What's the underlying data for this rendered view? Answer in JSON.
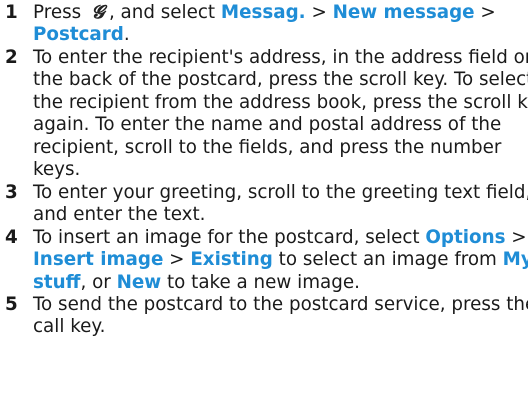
{
  "colors": {
    "text": "#1a1a1a",
    "highlight": "#1f8dd6",
    "background": "#ffffff"
  },
  "icons": {
    "menu_key": "menu-key-icon"
  },
  "steps": [
    {
      "number": "1",
      "lines": [
        [
          {
            "t": "Press "
          },
          {
            "icon": "menu-key-icon",
            "glyph": "𝓖"
          },
          {
            "t": ", and select "
          },
          {
            "t": "Messag.",
            "hl": true
          },
          {
            "t": " > "
          },
          {
            "t": "New message",
            "hl": true
          },
          {
            "t": " >"
          }
        ],
        [
          {
            "t": "Postcard",
            "hl": true
          },
          {
            "t": "."
          }
        ]
      ]
    },
    {
      "number": "2",
      "lines": [
        [
          {
            "t": " To enter the recipient's address, in the address field on"
          }
        ],
        [
          {
            "t": "the back of the postcard, press the scroll key. To select"
          }
        ],
        [
          {
            "t": "the recipient from the address book, press the scroll key"
          }
        ],
        [
          {
            "t": "again. To enter the name and postal address of the"
          }
        ],
        [
          {
            "t": "recipient, scroll to the fields, and press the number"
          }
        ],
        [
          {
            "t": "keys."
          }
        ]
      ]
    },
    {
      "number": "3",
      "lines": [
        [
          {
            "t": "To enter your greeting, scroll to the greeting text field,"
          }
        ],
        [
          {
            "t": "and enter the text."
          }
        ]
      ]
    },
    {
      "number": "4",
      "lines": [
        [
          {
            "t": "To insert an image for the postcard, select "
          },
          {
            "t": "Options",
            "hl": true
          },
          {
            "t": " >"
          }
        ],
        [
          {
            "t": "Insert image",
            "hl": true
          },
          {
            "t": " > "
          },
          {
            "t": "Existing",
            "hl": true
          },
          {
            "t": " to select an image from "
          },
          {
            "t": "My",
            "hl": true
          }
        ],
        [
          {
            "t": "stuff",
            "hl": true
          },
          {
            "t": ", or "
          },
          {
            "t": "New",
            "hl": true
          },
          {
            "t": " to take a new image."
          }
        ]
      ]
    },
    {
      "number": "5",
      "lines": [
        [
          {
            "t": "To send the postcard to the postcard service, press the"
          }
        ],
        [
          {
            "t": "call key."
          }
        ]
      ]
    }
  ]
}
